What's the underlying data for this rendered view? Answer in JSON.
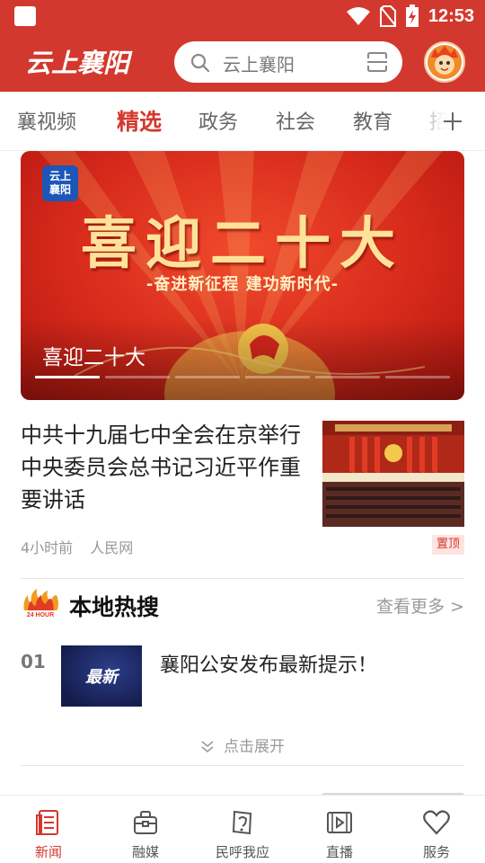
{
  "status_bar": {
    "time": "12:53"
  },
  "header": {
    "logo_text": "云上襄阳",
    "search_placeholder": "云上襄阳"
  },
  "tabs": [
    {
      "label": "襄视频",
      "active": false
    },
    {
      "label": "精选",
      "active": true
    },
    {
      "label": "政务",
      "active": false
    },
    {
      "label": "社会",
      "active": false
    },
    {
      "label": "教育",
      "active": false
    },
    {
      "label": "招",
      "active": false
    }
  ],
  "banner": {
    "badge_text": "云上襄阳",
    "big_title": "喜迎二十大",
    "slogan": "-奋进新征程  建功新时代-",
    "caption": "喜迎二十大",
    "slide_count": 6,
    "active_slide": 0
  },
  "news": {
    "title": "中共十九届七中全会在京举行 中央委员会总书记习近平作重要讲话",
    "time": "4小时前",
    "source": "人民网",
    "pin_label": "置顶"
  },
  "hot_search": {
    "title": "本地热搜",
    "more": "查看更多 >",
    "flame_label": "24 HOUR",
    "items": [
      {
        "rank": "01",
        "thumb_text": "最新",
        "text": "襄阳公安发布最新提示！"
      }
    ],
    "expand_label": "点击展开"
  },
  "bottom_nav": [
    {
      "label": "新闻",
      "icon": "news-icon",
      "active": true
    },
    {
      "label": "融媒",
      "icon": "media-bag-icon",
      "active": false
    },
    {
      "label": "民呼我应",
      "icon": "public-voice-icon",
      "active": false
    },
    {
      "label": "直播",
      "icon": "live-video-icon",
      "active": false
    },
    {
      "label": "服务",
      "icon": "heart-icon",
      "active": false
    }
  ],
  "colors": {
    "brand_red": "#d3382e",
    "banner_gold": "#ffe29a",
    "hot_bg": "#141c4c"
  }
}
